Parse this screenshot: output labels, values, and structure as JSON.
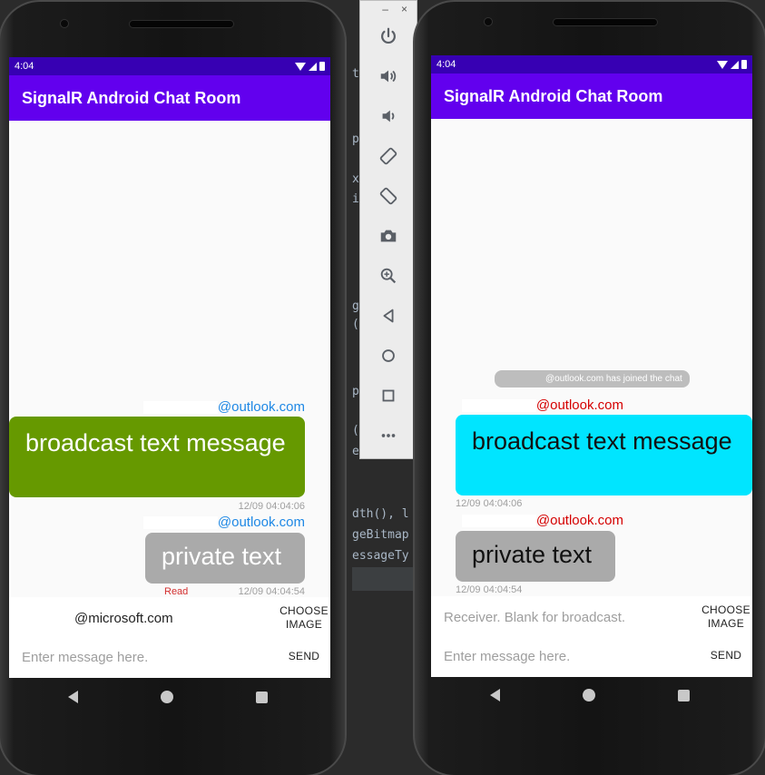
{
  "emulator_toolbar": {
    "minimize": "–",
    "close": "×",
    "icons": [
      "power-icon",
      "volume-up-icon",
      "volume-down-icon",
      "rotate-left-icon",
      "rotate-right-icon",
      "camera-icon",
      "zoom-icon",
      "back-icon",
      "home-icon",
      "overview-icon",
      "more-icon"
    ]
  },
  "code_editor": {
    "lines": [
      {
        "text": "t"
      },
      {
        "text": "p"
      },
      {
        "text": "x"
      },
      {
        "text": "i"
      },
      {
        "text": "g"
      },
      {
        "text": "("
      },
      {
        "text": "p"
      },
      {
        "text": "("
      },
      {
        "text": "e"
      },
      {
        "text": "dth(), l"
      },
      {
        "text": "geBitmap"
      },
      {
        "text": "essageTy"
      }
    ]
  },
  "left_phone": {
    "status_time": "4:04",
    "app_title": "SignalR Android Chat Room",
    "messages": [
      {
        "sender_suffix": "@outlook.com",
        "text": "broadcast text message",
        "time": "12/09 04:04:06"
      },
      {
        "sender_suffix": "@outlook.com",
        "text": "private text",
        "time": "12/09 04:04:54",
        "status": "Read"
      }
    ],
    "receiver_value": "@microsoft.com",
    "message_placeholder": "Enter message here.",
    "choose_image_label": "CHOOSE IMAGE",
    "send_label": "SEND"
  },
  "right_phone": {
    "status_time": "4:04",
    "app_title": "SignalR Android Chat Room",
    "join_notice": "@outlook.com has joined the chat",
    "messages": [
      {
        "sender_suffix": "@outlook.com",
        "text": "broadcast text message",
        "time": "12/09 04:04:06"
      },
      {
        "sender_suffix": "@outlook.com",
        "text": "private text",
        "time": "12/09 04:04:54"
      }
    ],
    "receiver_placeholder": "Receiver. Blank for broadcast.",
    "message_placeholder": "Enter message here.",
    "choose_image_label": "CHOOSE IMAGE",
    "send_label": "SEND"
  },
  "colors": {
    "status_bar": "#3700b3",
    "app_bar": "#6200ee",
    "left_broadcast_bubble": "#669900",
    "right_broadcast_bubble": "#00e5ff",
    "private_bubble": "#aaaaaa",
    "left_sender": "#1e88e5",
    "right_sender": "#d50000",
    "read_status": "#d32f2f"
  }
}
